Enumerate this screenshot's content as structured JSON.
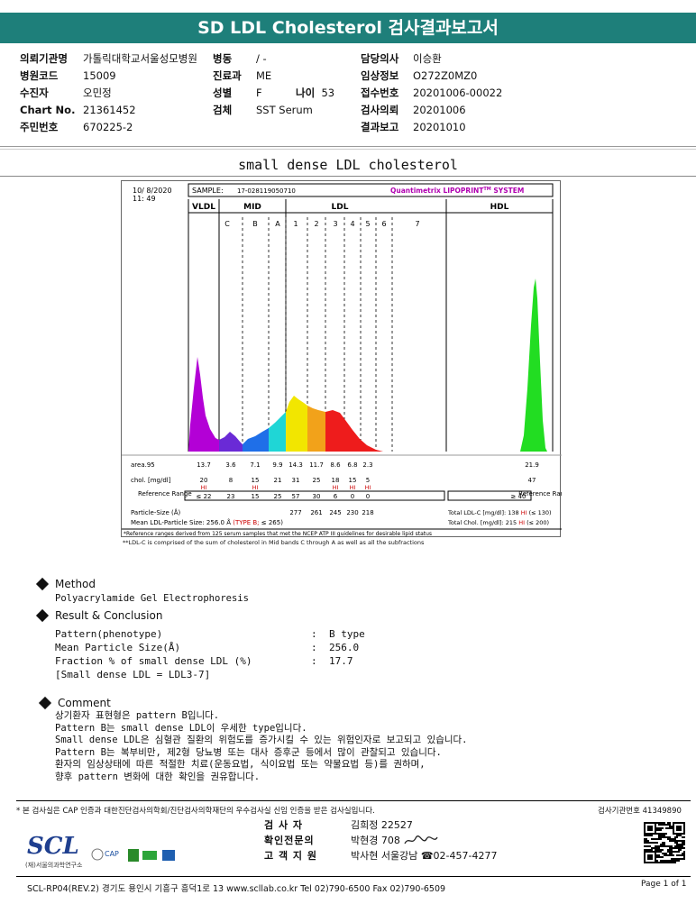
{
  "report": {
    "title": "SD LDL Cholesterol 검사결과보고서",
    "fields_left": [
      {
        "label": "의뢰기관명",
        "value": "가톨릭대학교서울성모병원"
      },
      {
        "label": "병원코드",
        "value": "15009"
      },
      {
        "label": "수진자",
        "value": "오민정"
      },
      {
        "label": "Chart No.",
        "value": "21361452"
      },
      {
        "label": "주민번호",
        "value": "670225-2"
      }
    ],
    "fields_mid": [
      {
        "label": "병동",
        "value": "/ -"
      },
      {
        "label": "진료과",
        "value": "ME"
      },
      {
        "label": "성별",
        "value": "F"
      },
      {
        "label": "검체",
        "value": "SST Serum"
      }
    ],
    "age_label": "나이",
    "age_value": "53",
    "fields_right": [
      {
        "label": "담당의사",
        "value": "이승환"
      },
      {
        "label": "임상정보",
        "value": "O272Z0MZ0"
      },
      {
        "label": "접수번호",
        "value": "20201006-00022"
      },
      {
        "label": "검사의뢰",
        "value": "20201006"
      },
      {
        "label": "결과보고",
        "value": "20201010"
      }
    ]
  },
  "section_title": "small dense LDL cholesterol",
  "chart_data": {
    "type": "area",
    "date": "10/ 8/2020",
    "time": "11: 49",
    "sample_label": "SAMPLE:",
    "sample_id": "17-028119050710",
    "system": "Quantimetrix LIPOPRINT",
    "system_tm": "TM",
    "system_suffix": " SYSTEM",
    "groups": [
      "VLDL",
      "MID",
      "LDL",
      "HDL"
    ],
    "bands": [
      "C",
      "B",
      "A",
      "1",
      "2",
      "3",
      "4",
      "5",
      "6",
      "7"
    ],
    "row_labels": {
      "area": "area.95",
      "chol": "chol. [mg/dl]",
      "ref": "Reference Range",
      "ref_right": "Reference Range",
      "ps": "Particle-Size (Å)",
      "mean": "Mean LDL-Particle Size:"
    },
    "area_values": [
      "13.7",
      "3.6",
      "7.1",
      "9.9",
      "14.3",
      "11.7",
      "8.6",
      "6.8",
      "2.3",
      "21.9"
    ],
    "chol_values": [
      "20",
      "8",
      "15",
      "21",
      "31",
      "25",
      "18",
      "15",
      "5",
      "47"
    ],
    "chol_flags": [
      "HI",
      "",
      "HI",
      "",
      "",
      "",
      "HI",
      "HI",
      "HI",
      ""
    ],
    "ref_values": [
      "≤ 22",
      "23",
      "15",
      "25",
      "57",
      "30",
      "6",
      "0",
      "0",
      "≥ 40"
    ],
    "particle_sizes": [
      "277",
      "261",
      "245",
      "230",
      "218"
    ],
    "mean_size": "256.0 Å",
    "mean_type": "(TYPE B;",
    "mean_type_rule": "≤ 265)",
    "total_ldl_label": "Total LDL-C [mg/dl]:",
    "total_ldl_value": "138",
    "total_ldl_flag": "HI",
    "total_ldl_ref": "(≤ 130)",
    "total_chol_label": "Total Chol. [mg/dl]:",
    "total_chol_value": "215",
    "total_chol_flag": "HI",
    "total_chol_ref": "(≤ 200)",
    "note1": "*Reference ranges derived from 125 serum samples that met the NCEP ATP III guidelines for desirable lipid status",
    "note2": "**LDL-C is comprised of the sum of cholesterol in Mid bands C through A as well as all the subfractions",
    "colors": {
      "vldl": "#b300d6",
      "c": "#6a2ad6",
      "b": "#1f6fe8",
      "a": "#1fd6d6",
      "l1": "#f2e600",
      "l2": "#f2a21a",
      "l3": "#ee1c1c",
      "hdl": "#22dd22"
    }
  },
  "method": {
    "heading": "Method",
    "text": "Polyacrylamide Gel Electrophoresis"
  },
  "result": {
    "heading": "Result & Conclusion",
    "rows": [
      {
        "label": "Pattern(phenotype)",
        "value": "B type"
      },
      {
        "label": "Mean Particle Size(Å)",
        "value": "256.0"
      },
      {
        "label": "Fraction % of small dense LDL (%)",
        "value": "17.7"
      }
    ],
    "note": "[Small dense LDL = LDL3-7]"
  },
  "comment": {
    "heading": "Comment",
    "lines": [
      "상기환자 표현형은 pattern B입니다.",
      "Pattern B는 small dense LDL이 우세한 type입니다.",
      "Small dense LDL은 심혈관 질환의 위험도를 증가시킬 수 있는 위험인자로 보고되고 있습니다.",
      "Pattern B는 복부비만, 제2형 당뇨병 또는 대사 증후군 등에서 많이 관찰되고 있습니다.",
      "환자의 임상상태에 따른 적절한 치료(운동요법, 식이요법 또는 약물요법 등)를 권하며,",
      "향후 pattern 변화에 대한 확인을 권유합니다."
    ]
  },
  "footer": {
    "cert_text": "* 본 검사실은 CAP 인증과 대한진단검사의학회/진단검사의학재단의 우수검사실 신임 인증을 받은 검사실입니다.",
    "institution_no": "검사기관번호 41349890",
    "staff": [
      {
        "role": "검 사 자",
        "name": "김희정 22527"
      },
      {
        "role": "확인전문의",
        "name": "박현경 708"
      },
      {
        "role": "고 객 지 원",
        "name": "박사현 서울강남 ☎02-457-4277"
      }
    ],
    "logo": "SCL",
    "logo_sub": "(재)서울의과학연구소",
    "cap_logo": "CAP",
    "address": "SCL-RP04(REV.2)  경기도 용인시 기흥구 흥덕1로 13  www.scllab.co.kr  Tel 02)790-6500  Fax 02)790-6509",
    "page": "Page 1 of 1"
  }
}
